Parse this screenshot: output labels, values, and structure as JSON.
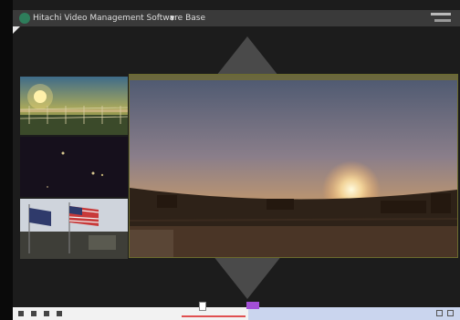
{
  "app": {
    "title": "Hitachi Video Management Software Base"
  },
  "timeline": {
    "tooltip": "",
    "ticks": [
      "",
      "",
      "",
      "",
      "",
      "",
      "",
      ""
    ]
  },
  "colors": {
    "timeline_bar": "#f2f2f2",
    "playback_highlight": "#e05050",
    "selection": "#a24fd6"
  },
  "icons": {
    "app": "hitachi-logo-icon",
    "menu": "chevron-down-icon",
    "play": "play-icon",
    "pause": "pause-icon",
    "skip": "skip-icon"
  }
}
